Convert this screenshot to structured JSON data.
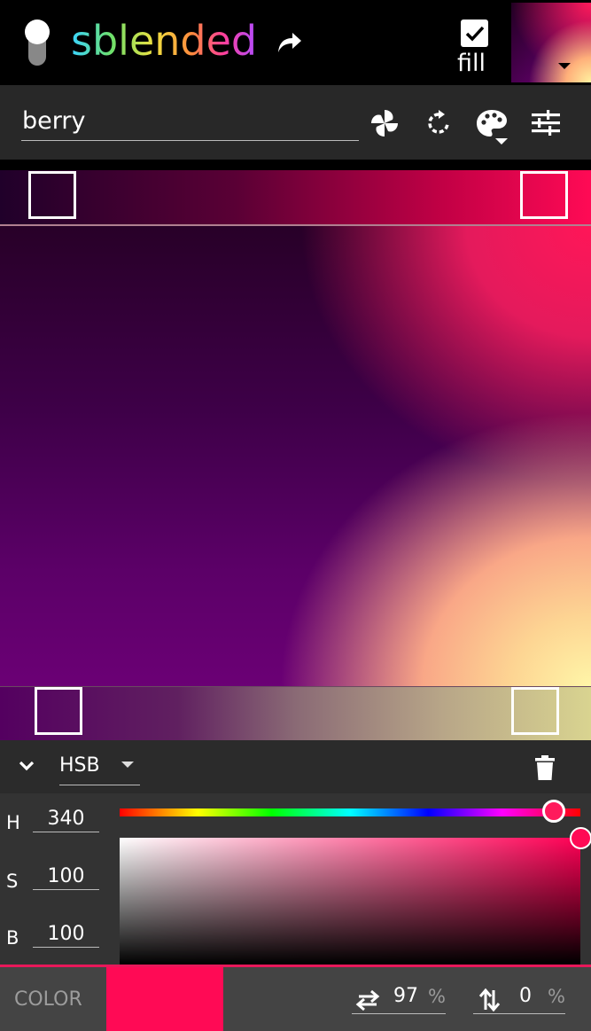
{
  "app": {
    "logo_text": "sblended",
    "fill_label": "fill",
    "fill_checked": true
  },
  "palette": {
    "name": "berry",
    "placeholder": ""
  },
  "toolbar": {
    "icons": [
      "pinwheel-icon",
      "refresh-icon",
      "palette-icon",
      "tune-icon"
    ]
  },
  "corners": {
    "top_left": "#20002a",
    "top_right": "#ff0a55",
    "bottom_left": "#650075",
    "bottom_right": "#fff8a6"
  },
  "editor": {
    "model": "HSB",
    "channels": [
      {
        "label": "H",
        "value": "340"
      },
      {
        "label": "S",
        "value": "100"
      },
      {
        "label": "B",
        "value": "100"
      }
    ],
    "hue": 340,
    "saturation": 100,
    "brightness": 100
  },
  "bottom": {
    "color_label": "COLOR",
    "swatch_color": "#ff0a55",
    "x_value": "97",
    "x_unit": "%",
    "y_value": "0",
    "y_unit": "%"
  }
}
